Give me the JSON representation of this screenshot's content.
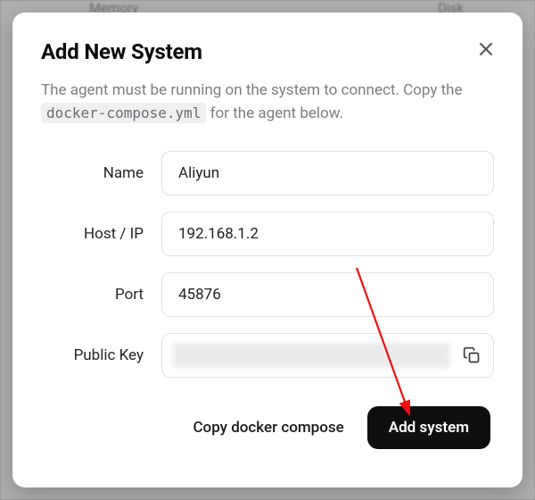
{
  "backdrop": {
    "left_label": "Memory",
    "right_label": "Disk"
  },
  "modal": {
    "title": "Add New System",
    "description_before": "The agent must be running on the system to connect. Copy the ",
    "description_code": "docker-compose.yml",
    "description_after": " for the agent below."
  },
  "form": {
    "name": {
      "label": "Name",
      "value": "Aliyun"
    },
    "host": {
      "label": "Host / IP",
      "value": "192.168.1.2"
    },
    "port": {
      "label": "Port",
      "value": "45876"
    },
    "public_key": {
      "label": "Public Key"
    }
  },
  "footer": {
    "copy_compose": "Copy docker compose",
    "add_system": "Add system"
  }
}
